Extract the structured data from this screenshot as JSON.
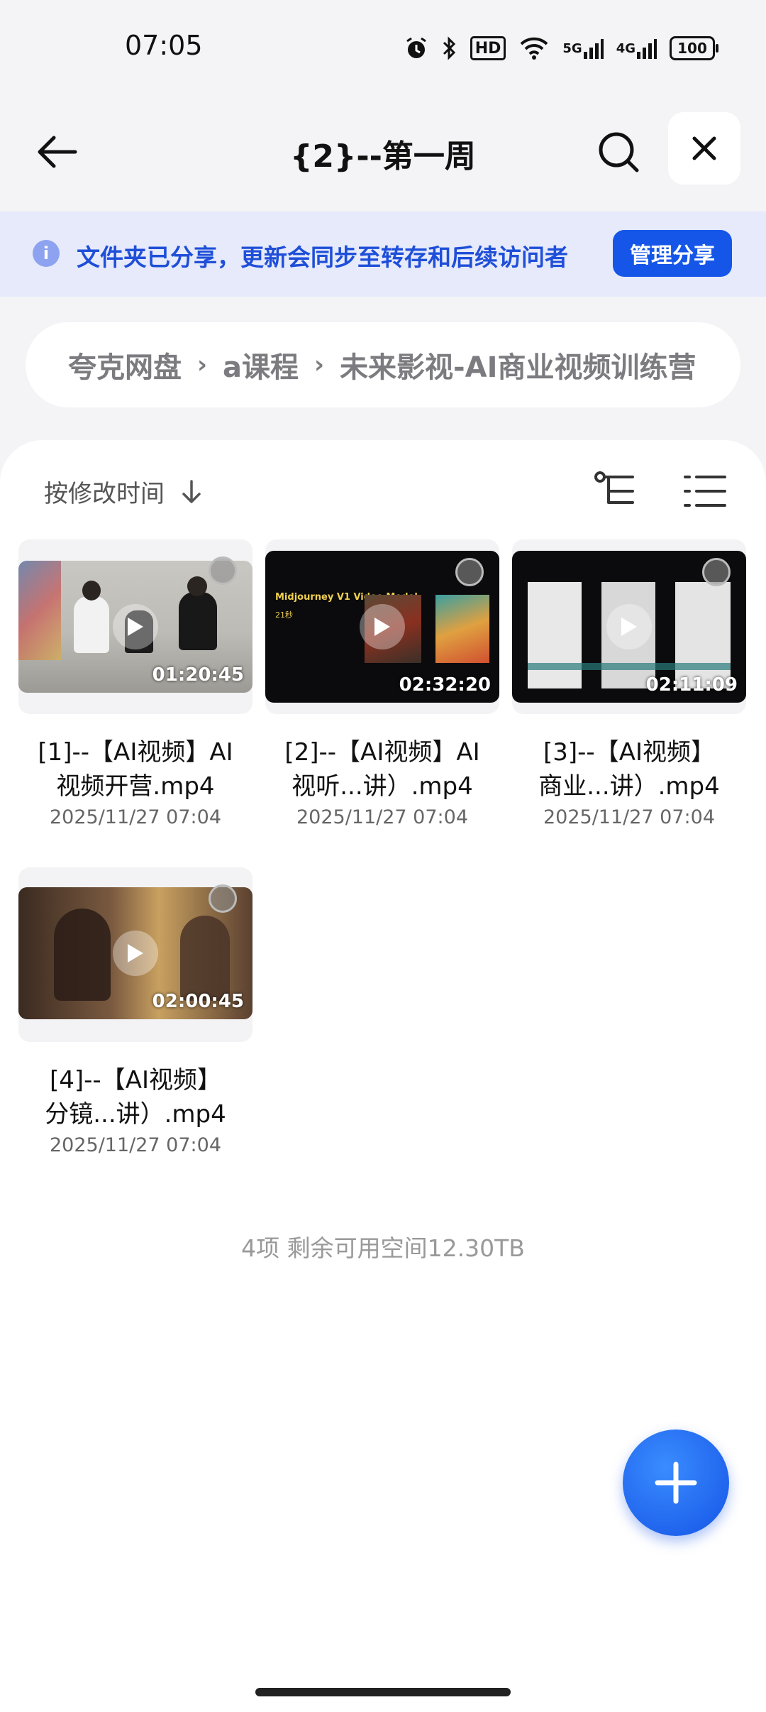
{
  "status_bar": {
    "time": "07:05",
    "network_5g": "5G",
    "network_4g": "4G",
    "hd_label": "HD",
    "battery": "100"
  },
  "header": {
    "title": "{2}--第一周"
  },
  "banner": {
    "text": "文件夹已分享，更新会同步至转存和后续访问者",
    "button": "管理分享",
    "info_icon": "i"
  },
  "breadcrumb": {
    "items": [
      "夸克网盘",
      "a课程",
      "未来影视-AI商业视频训练营"
    ]
  },
  "sort": {
    "label": "按修改时间"
  },
  "files": [
    {
      "name_line1": "[1]--【AI视频】AI",
      "name_line2": "视频开营.mp4",
      "date": "2025/11/27 07:04",
      "duration": "01:20:45"
    },
    {
      "name_line1": "[2]--【AI视频】AI",
      "name_line2": "视听...讲）.mp4",
      "date": "2025/11/27 07:04",
      "duration": "02:32:20",
      "thumb_title": "Midjourney V1 Video Model",
      "thumb_sub": "21秒"
    },
    {
      "name_line1": "[3]--【AI视频】",
      "name_line2": "商业...讲）.mp4",
      "date": "2025/11/27 07:04",
      "duration": "02:11:09"
    },
    {
      "name_line1": "[4]--【AI视频】",
      "name_line2": "分镜...讲）.mp4",
      "date": "2025/11/27 07:04",
      "duration": "02:00:45"
    }
  ],
  "footer": {
    "info": "4项 剩余可用空间12.30TB"
  },
  "colors": {
    "accent": "#1556e8",
    "banner_bg": "#e6eafb",
    "banner_text": "#1f4fd8"
  }
}
